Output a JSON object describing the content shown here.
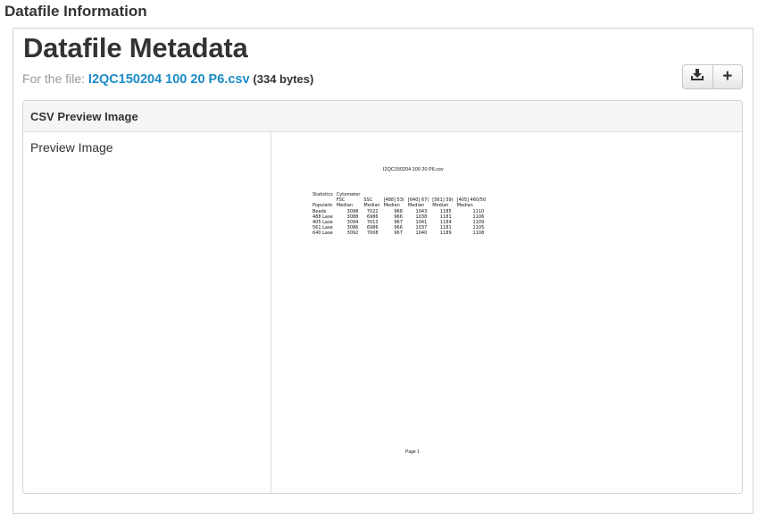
{
  "section": {
    "title": "Datafile Information"
  },
  "metadata": {
    "title": "Datafile Metadata",
    "file_prefix": "For the file:",
    "file_name": "I2QC150204 100 20 P6.csv",
    "file_size": "(334 bytes)"
  },
  "toolbar": {
    "download_icon": "download-icon",
    "add_label": "+"
  },
  "panel": {
    "heading": "CSV Preview Image",
    "row_label": "Preview Image"
  },
  "preview": {
    "doc_title": "I2QC150204 100 20 P6.csv",
    "header_rows": [
      [
        "Statistics",
        "Cytometer",
        "",
        "",
        "",
        "",
        "",
        ""
      ],
      [
        "",
        "FSC",
        "SSC",
        "[488] 53(",
        "[640] 67(",
        "[561] 59(",
        "[405] 460/50",
        ""
      ],
      [
        "Populatic",
        "Median",
        "Median",
        "Median",
        "Median",
        "Median",
        "Median",
        ""
      ]
    ],
    "data_rows": [
      [
        "Beads",
        "3098",
        "7022",
        "968",
        "1043",
        "1185",
        "1110"
      ],
      [
        "488 Lase",
        "3088",
        "6986",
        "966",
        "1038",
        "1181",
        "1106"
      ],
      [
        "405 Lase",
        "3094",
        "7013",
        "967",
        "1041",
        "1184",
        "1109"
      ],
      [
        "561 Lase",
        "3086",
        "6986",
        "966",
        "1037",
        "1181",
        "1105"
      ],
      [
        "640 Lase",
        "3092",
        "7008",
        "967",
        "1040",
        "1189",
        "1108"
      ]
    ],
    "page_label": "Page 1"
  }
}
